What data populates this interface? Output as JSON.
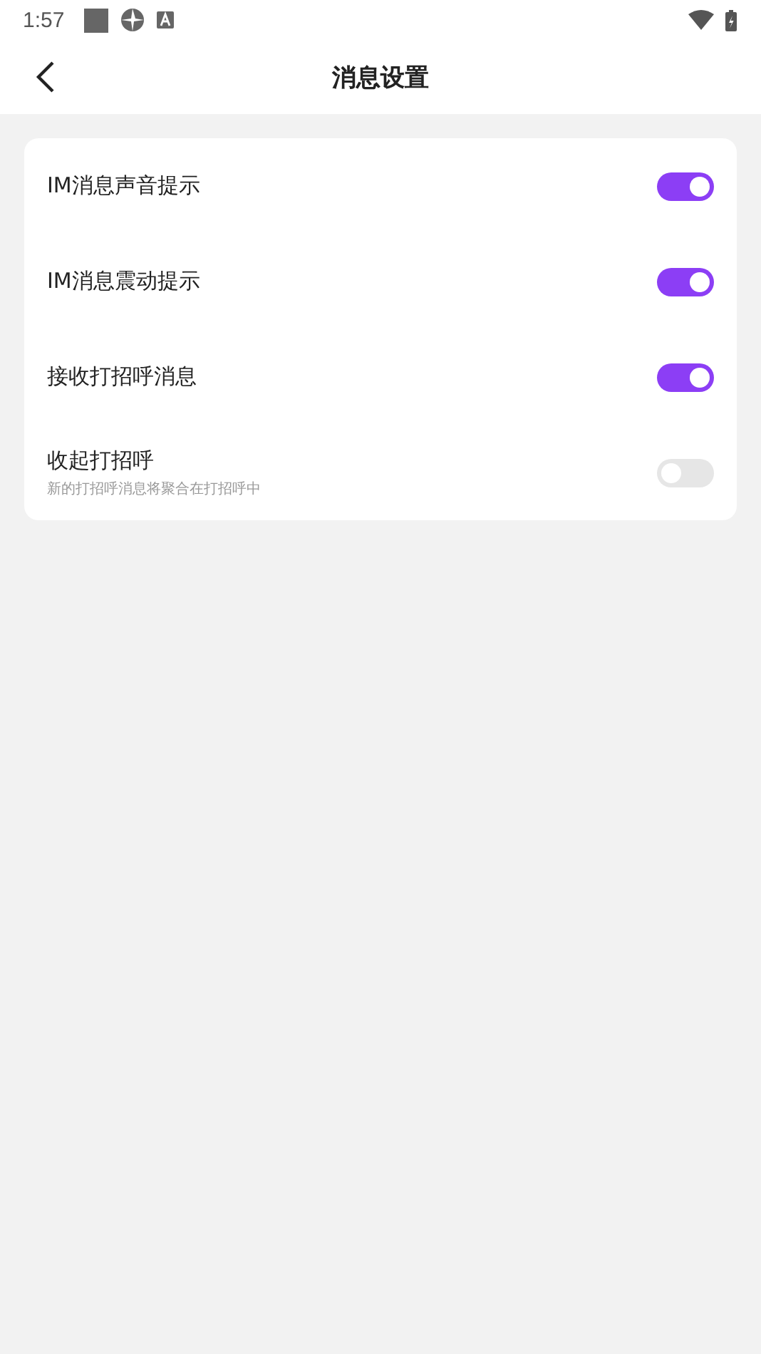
{
  "status_bar": {
    "time": "1:57"
  },
  "header": {
    "title": "消息设置"
  },
  "settings": [
    {
      "label": "IM消息声音提示",
      "on": true
    },
    {
      "label": "IM消息震动提示",
      "on": true
    },
    {
      "label": "接收打招呼消息",
      "on": true
    },
    {
      "label": "收起打招呼",
      "subtitle": "新的打招呼消息将聚合在打招呼中",
      "on": false
    }
  ]
}
